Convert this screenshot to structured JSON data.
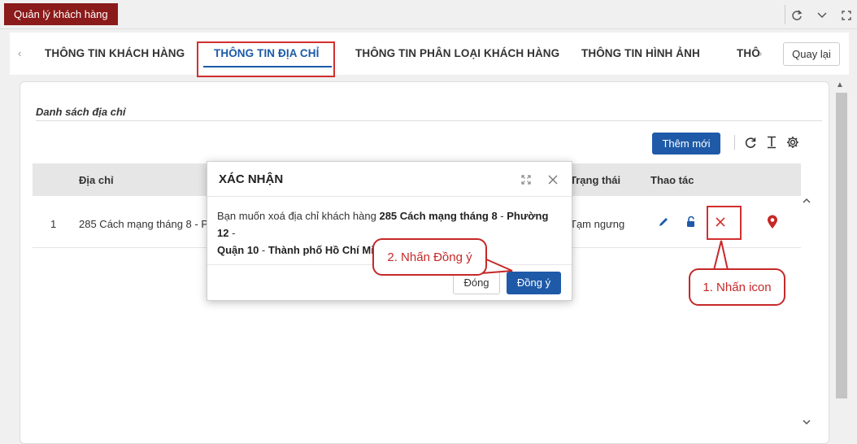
{
  "topbar": {
    "app_tab": "Quản lý khách hàng"
  },
  "tabs": {
    "items": [
      {
        "label": "THÔNG TIN KHÁCH HÀNG"
      },
      {
        "label": "THÔNG TIN ĐỊA CHỈ"
      },
      {
        "label": "THÔNG TIN PHÂN LOẠI KHÁCH HÀNG"
      },
      {
        "label": "THÔNG TIN HÌNH ẢNH"
      },
      {
        "label": "THÔ"
      }
    ],
    "active_index": 1,
    "back_label": "Quay lại"
  },
  "section": {
    "title": "Danh sách địa chỉ",
    "add_label": "Thêm mới"
  },
  "table": {
    "headers": {
      "address": "Địa chỉ",
      "status": "Trạng thái",
      "actions": "Thao tác"
    },
    "rows": [
      {
        "index": "1",
        "address": "285 Cách mạng tháng 8 - Phư",
        "status": "Tạm ngưng"
      }
    ]
  },
  "dialog": {
    "title": "XÁC NHẬN",
    "message_prefix": "Bạn muốn xoá địa chỉ khách hàng ",
    "address_1": "285 Cách mạng tháng 8",
    "sep_1": " - ",
    "address_2": "Phường 12",
    "sep_2": " - ",
    "address_3": "Quận 10",
    "sep_3": " - ",
    "address_4": "Thành phố Hồ Chí Minh",
    "message_suffix": "?",
    "close_label": "Đóng",
    "ok_label": "Đồng ý"
  },
  "callouts": {
    "step1": "1. Nhấn icon",
    "step2": "2. Nhấn Đồng ý"
  },
  "colors": {
    "brand": "#8b1a1a",
    "primary": "#1e5aa8",
    "highlight": "#d32f2f",
    "delete": "#d32f2f",
    "location": "#c62828"
  }
}
